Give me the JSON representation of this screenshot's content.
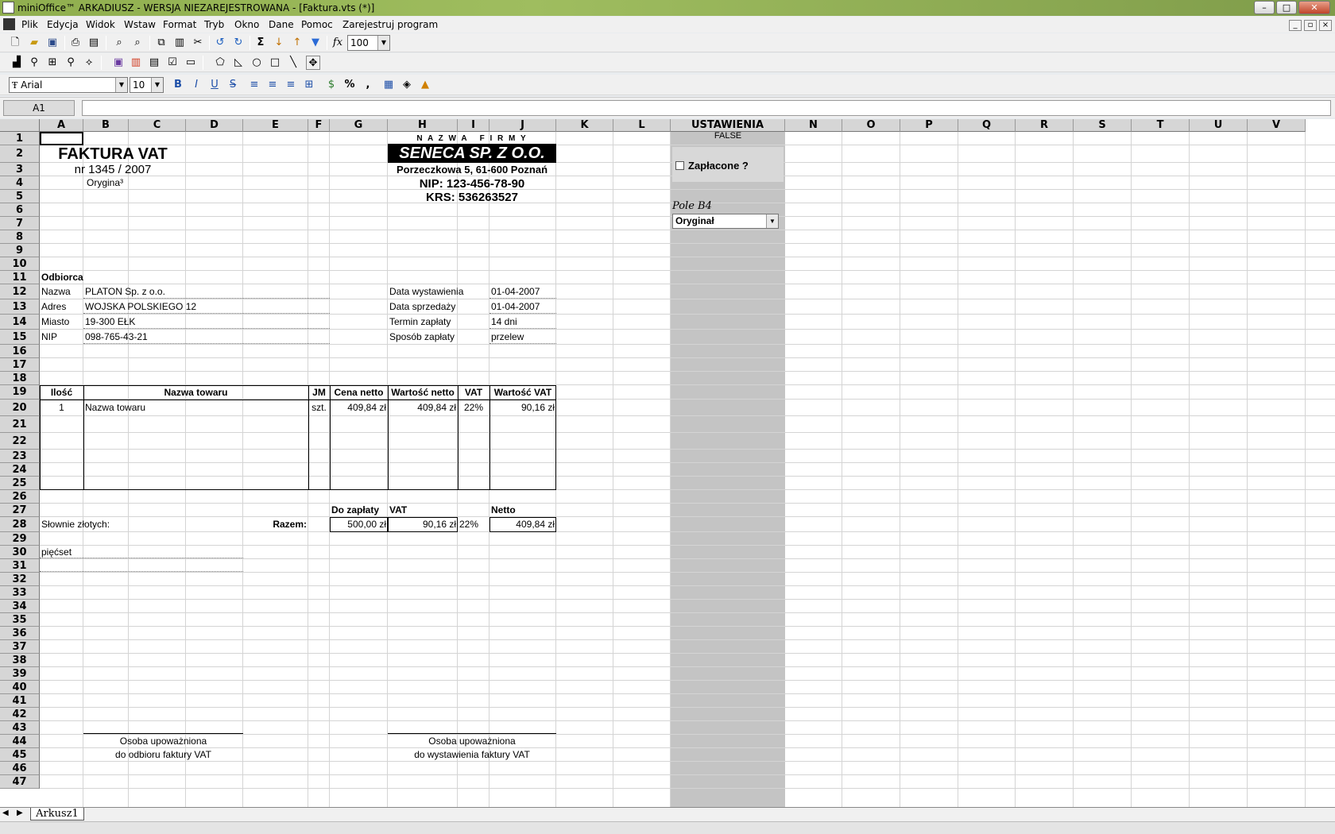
{
  "window": {
    "title": "miniOffice™  ARKADIUSZ - WERSJA NIEZAREJESTROWANA - [Faktura.vts (*)]",
    "minimize": "–",
    "maximize": "□",
    "close": "✕"
  },
  "menu": [
    "Plik",
    "Edycja",
    "Widok",
    "Wstaw",
    "Format",
    "Tryb",
    "Okno",
    "Dane",
    "Pomoc",
    "Zarejestruj program"
  ],
  "toolbar": {
    "zoom": "100",
    "font": "Arial",
    "size": "10",
    "sum_icon": "Σ",
    "fx": "fx",
    "percent": "%",
    "comma": ","
  },
  "formula": {
    "cell": "A1",
    "content": ""
  },
  "columns": [
    "A",
    "B",
    "C",
    "D",
    "E",
    "F",
    "G",
    "H",
    "I",
    "J",
    "K",
    "L",
    "USTAWIENIA",
    "N",
    "O",
    "P",
    "Q",
    "R",
    "S",
    "T",
    "U",
    "V"
  ],
  "rows": [
    "1",
    "2",
    "3",
    "4",
    "5",
    "6",
    "7",
    "8",
    "9",
    "10",
    "11",
    "12",
    "13",
    "14",
    "15",
    "16",
    "17",
    "18",
    "19",
    "20",
    "21",
    "22",
    "23",
    "24",
    "25",
    "26",
    "27",
    "28",
    "29",
    "30",
    "31",
    "32",
    "33",
    "34",
    "35",
    "36",
    "37",
    "38",
    "39",
    "40",
    "41",
    "42",
    "43",
    "44",
    "45",
    "46",
    "47"
  ],
  "invoice": {
    "title": "FAKTURA VAT",
    "number": "nr 1345 / 2007",
    "copy": "Orygina³",
    "company_label": "N A Z W A   F I R M Y",
    "company": "SENECA SP. Z O.O.",
    "address": "Porzeczkowa 5, 61-600 Poznań",
    "nip": "NIP: 123-456-78-90",
    "krs": "KRS: 536263527",
    "recipient_label": "Odbiorca",
    "recipient": [
      {
        "k": "Nazwa",
        "v": "PLATON Sp. z o.o."
      },
      {
        "k": "Adres",
        "v": "WOJSKA POLSKIEGO 12"
      },
      {
        "k": "Miasto",
        "v": "19-300 EŁK"
      },
      {
        "k": "NIP",
        "v": "098-765-43-21"
      }
    ],
    "dates": [
      {
        "k": "Data wystawienia",
        "v": "01-04-2007"
      },
      {
        "k": "Data sprzedaży",
        "v": "01-04-2007"
      },
      {
        "k": "Termin zapłaty",
        "v": "14 dni"
      },
      {
        "k": "Sposób zapłaty",
        "v": "przelew"
      }
    ],
    "table_headers": [
      "Ilość",
      "Nazwa towaru",
      "JM",
      "Cena netto",
      "Wartość netto",
      "VAT",
      "Wartość VAT"
    ],
    "item": {
      "qty": "1",
      "name": "Nazwa towaru",
      "unit": "szt.",
      "price": "409,84 zł",
      "net": "409,84 zł",
      "vat": "22%",
      "vat_value": "90,16 zł"
    },
    "totals_labels": {
      "pay": "Do zapłaty",
      "vat": "VAT",
      "net": "Netto"
    },
    "words_label": "Słownie złotych:",
    "razem": "Razem:",
    "totals": {
      "pay": "500,00 zł",
      "vat": "90,16 zł",
      "vat_rate": "22%",
      "net": "409,84 zł"
    },
    "words": "pięćset",
    "sign_left": [
      "Osoba upoważniona",
      "do odbioru faktury VAT"
    ],
    "sign_right": [
      "Osoba upoważniona",
      "do wystawienia faktury VAT"
    ]
  },
  "settings": {
    "false_value": "FALSE",
    "paid_label": "Zapłacone ?",
    "field_label": "Pole B4",
    "select_value": "Oryginał"
  },
  "sheet_tab": "Arkusz1"
}
